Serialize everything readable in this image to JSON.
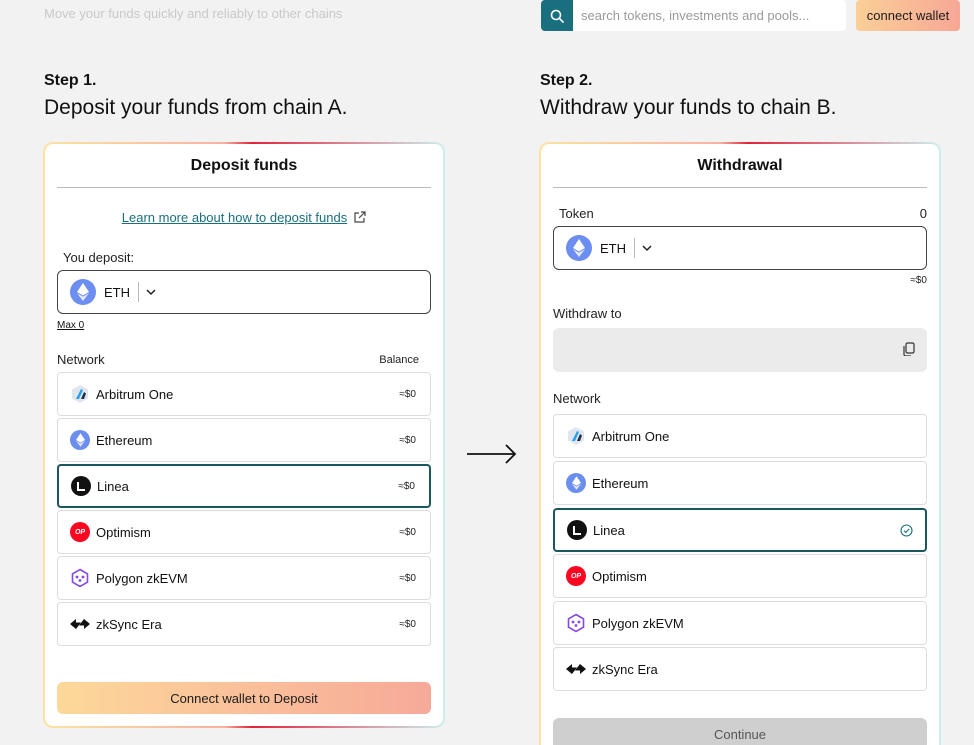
{
  "header": {
    "faded_subtitle": "Move your funds quickly and reliably to other chains",
    "search_placeholder": "search tokens, investments and pools...",
    "connect_wallet_label": "connect wallet"
  },
  "step1": {
    "label": "Step 1.",
    "title": "Deposit your funds from chain A.",
    "card": {
      "title": "Deposit funds",
      "learn_more": "Learn more about how to deposit funds",
      "you_deposit_label": "You deposit:",
      "token": "ETH",
      "max_label": "Max 0",
      "network_label": "Network",
      "balance_label": "Balance",
      "networks": [
        {
          "name": "Arbitrum One",
          "balance": "≈$0",
          "icon": "arbitrum-icon"
        },
        {
          "name": "Ethereum",
          "balance": "≈$0",
          "icon": "ethereum-icon"
        },
        {
          "name": "Linea",
          "balance": "≈$0",
          "icon": "linea-icon"
        },
        {
          "name": "Optimism",
          "balance": "≈$0",
          "icon": "optimism-icon"
        },
        {
          "name": "Polygon zkEVM",
          "balance": "≈$0",
          "icon": "polygon-icon"
        },
        {
          "name": "zkSync Era",
          "balance": "≈$0",
          "icon": "zksync-icon"
        }
      ],
      "selected_network": "Linea",
      "connect_button": "Connect wallet to Deposit"
    }
  },
  "step2": {
    "label": "Step 2.",
    "title": "Withdraw your funds to chain B.",
    "card": {
      "title": "Withdrawal",
      "token_label": "Token",
      "token_amount": "0",
      "token": "ETH",
      "token_value": "≈$0",
      "withdraw_to_label": "Withdraw to",
      "network_label": "Network",
      "networks": [
        {
          "name": "Arbitrum One",
          "icon": "arbitrum-icon"
        },
        {
          "name": "Ethereum",
          "icon": "ethereum-icon"
        },
        {
          "name": "Linea",
          "icon": "linea-icon"
        },
        {
          "name": "Optimism",
          "icon": "optimism-icon"
        },
        {
          "name": "Polygon zkEVM",
          "icon": "polygon-icon"
        },
        {
          "name": "zkSync Era",
          "icon": "zksync-icon"
        }
      ],
      "selected_network": "Linea",
      "continue_button": "Continue"
    }
  },
  "colors": {
    "accent_teal": "#1a6f7e",
    "selected_border": "#1a5560",
    "button_gradient_start": "#fdd89a",
    "button_gradient_end": "#f7a999"
  }
}
